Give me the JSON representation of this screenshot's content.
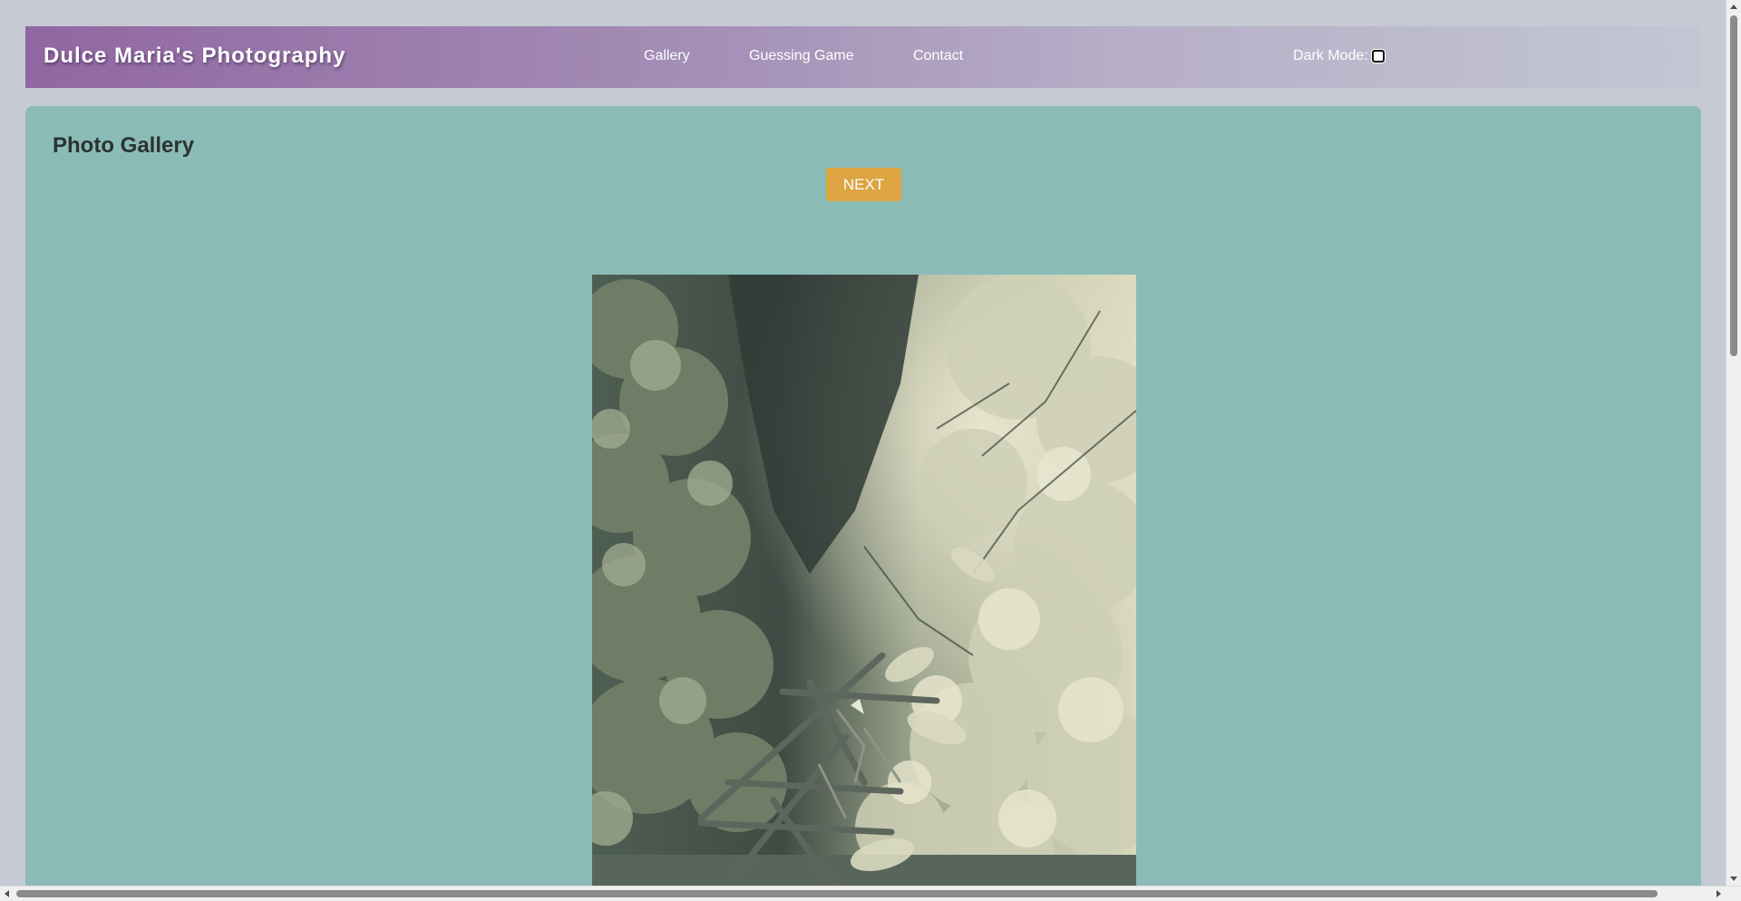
{
  "header": {
    "brand": "Dulce Maria's Photography",
    "nav": {
      "gallery": "Gallery",
      "game": "Guessing Game",
      "contact": "Contact"
    },
    "dark_mode_label": "Dark Mode:",
    "dark_mode_checked": false
  },
  "main": {
    "title": "Photo Gallery",
    "next_label": "NEXT",
    "photo": {
      "icon": "garden-photo",
      "description_hidden": true
    }
  },
  "colors": {
    "header_start": "#9167a2",
    "header_end": "#c2c7d3",
    "page_bg": "#c5cad4",
    "content_bg": "#8bbbb7",
    "button_bg": "#dda441",
    "title_text": "#2b3331"
  }
}
